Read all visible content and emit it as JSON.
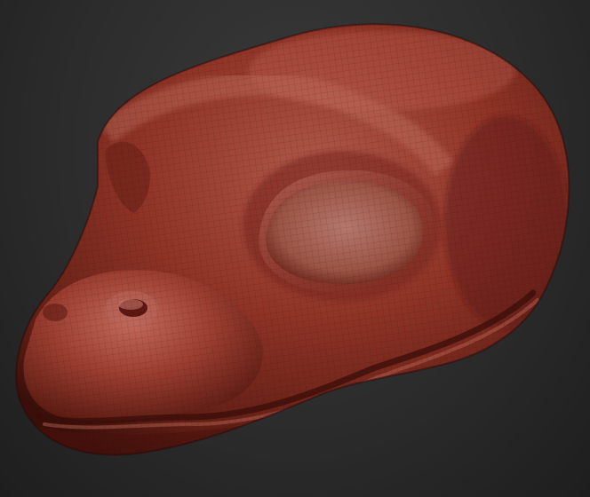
{
  "viewport": {
    "background_color": "#2b2b2b",
    "subject": "sculpted-reptile-head-mask",
    "material_color": "#8e3326",
    "highlight_color": "#c26a5c",
    "shadow_color": "#3a0f0a",
    "wireframe_visible": true
  }
}
